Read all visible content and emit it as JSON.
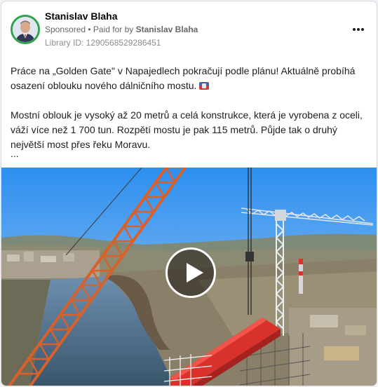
{
  "post": {
    "author": "Stanislav Blaha",
    "sponsored_label": "Sponsored",
    "separator": " • ",
    "paid_for_label": "Paid for by ",
    "paid_for_name": "Stanislav Blaha",
    "library_id": "Library ID: 1290568529286451",
    "paragraph_1": "Práce na „Golden Gate\" v Napajedlech pokračují podle plánu! Aktuálně probíhá osazení oblouku nového dálničního mostu.",
    "paragraph_2": "Mostní oblouk je vysoký až 20 metrů a celá konstrukce, která je vyrobena z oceli, váží více než 1 700 tun. Rozpětí mostu je pak 115 metrů. Půjde tak o druhý největší most přes řeku Moravu.",
    "ellipsis": "..."
  },
  "icons": {
    "more": "more-options-icon",
    "flag": "flag-icon",
    "play": "play-icon"
  },
  "colors": {
    "avatar_ring": "#31a24c",
    "crane_orange": "#d8612a",
    "bridge_red": "#d9312b"
  }
}
